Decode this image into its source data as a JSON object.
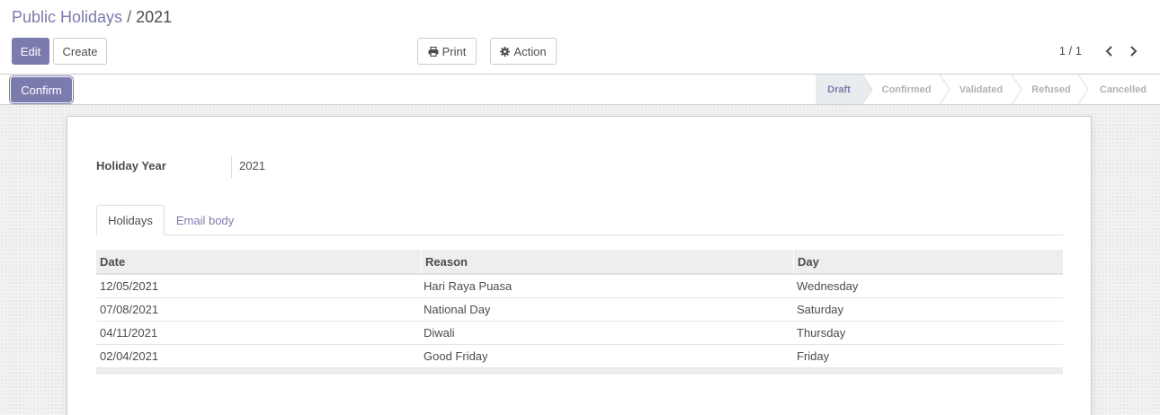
{
  "breadcrumb": {
    "parent": "Public Holidays",
    "separator": "/",
    "current": "2021"
  },
  "buttons": {
    "edit": "Edit",
    "create": "Create",
    "print": "Print",
    "action": "Action",
    "confirm": "Confirm"
  },
  "pager": {
    "value": "1 / 1"
  },
  "statusbar": {
    "steps": [
      {
        "label": "Draft",
        "active": true
      },
      {
        "label": "Confirmed",
        "active": false
      },
      {
        "label": "Validated",
        "active": false
      },
      {
        "label": "Refused",
        "active": false
      },
      {
        "label": "Cancelled",
        "active": false
      }
    ]
  },
  "form": {
    "holiday_year_label": "Holiday Year",
    "holiday_year_value": "2021"
  },
  "tabs": [
    {
      "label": "Holidays",
      "active": true
    },
    {
      "label": "Email body",
      "active": false
    }
  ],
  "table": {
    "columns": [
      "Date",
      "Reason",
      "Day"
    ],
    "rows": [
      [
        "12/05/2021",
        "Hari Raya Puasa",
        "Wednesday"
      ],
      [
        "07/08/2021",
        "National Day",
        "Saturday"
      ],
      [
        "04/11/2021",
        "Diwali",
        "Thursday"
      ],
      [
        "02/04/2021",
        "Good Friday",
        "Friday"
      ]
    ]
  },
  "colors": {
    "accent": "#7c7bad",
    "status_active_bg": "#e9ecef",
    "text": "#4c4c4c"
  }
}
